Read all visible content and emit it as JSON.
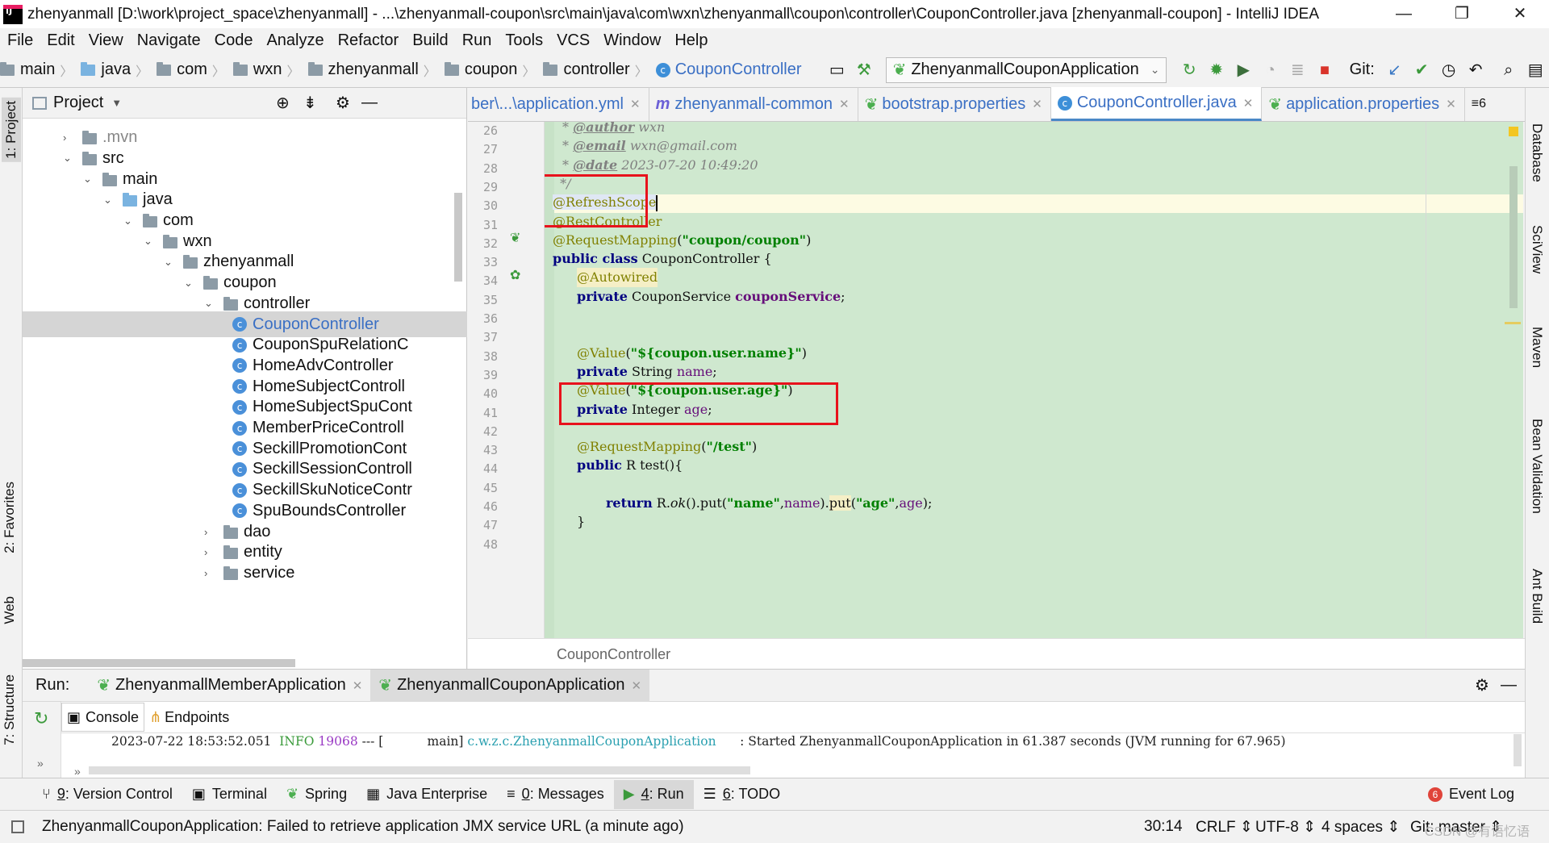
{
  "window": {
    "title": "zhenyanmall [D:\\work\\project_space\\zhenyanmall] - ...\\zhenyanmall-coupon\\src\\main\\java\\com\\wxn\\zhenyanmall\\coupon\\controller\\CouponController.java [zhenyanmall-coupon] - IntelliJ IDEA",
    "minimize": "—",
    "restore": "❐",
    "close": "✕"
  },
  "menu": [
    "File",
    "Edit",
    "View",
    "Navigate",
    "Code",
    "Analyze",
    "Refactor",
    "Build",
    "Run",
    "Tools",
    "VCS",
    "Window",
    "Help"
  ],
  "nav": {
    "crumbs": [
      "main",
      "java",
      "com",
      "wxn",
      "zhenyanmall",
      "coupon",
      "controller"
    ],
    "current_class": "CouponController",
    "run_config": "ZhenyanmallCouponApplication",
    "git_label": "Git:"
  },
  "project": {
    "header": "Project",
    "tree": [
      {
        "label": ".mvn",
        "indent": 0,
        "arrow": "›",
        "type": "folder"
      },
      {
        "label": "src",
        "indent": 0,
        "arrow": "⌄",
        "type": "folder"
      },
      {
        "label": "main",
        "indent": 1,
        "arrow": "⌄",
        "type": "folder"
      },
      {
        "label": "java",
        "indent": 2,
        "arrow": "⌄",
        "type": "folder-blue"
      },
      {
        "label": "com",
        "indent": 3,
        "arrow": "⌄",
        "type": "folder"
      },
      {
        "label": "wxn",
        "indent": 4,
        "arrow": "⌄",
        "type": "folder"
      },
      {
        "label": "zhenyanmall",
        "indent": 5,
        "arrow": "⌄",
        "type": "folder"
      },
      {
        "label": "coupon",
        "indent": 6,
        "arrow": "⌄",
        "type": "folder"
      },
      {
        "label": "controller",
        "indent": 7,
        "arrow": "⌄",
        "type": "folder"
      },
      {
        "label": "CouponController",
        "indent": 8,
        "arrow": "",
        "type": "class",
        "selected": true
      },
      {
        "label": "CouponSpuRelationC",
        "indent": 8,
        "arrow": "",
        "type": "class"
      },
      {
        "label": "HomeAdvController",
        "indent": 8,
        "arrow": "",
        "type": "class"
      },
      {
        "label": "HomeSubjectControll",
        "indent": 8,
        "arrow": "",
        "type": "class"
      },
      {
        "label": "HomeSubjectSpuCont",
        "indent": 8,
        "arrow": "",
        "type": "class"
      },
      {
        "label": "MemberPriceControll",
        "indent": 8,
        "arrow": "",
        "type": "class"
      },
      {
        "label": "SeckillPromotionCont",
        "indent": 8,
        "arrow": "",
        "type": "class"
      },
      {
        "label": "SeckillSessionControll",
        "indent": 8,
        "arrow": "",
        "type": "class"
      },
      {
        "label": "SeckillSkuNoticeContr",
        "indent": 8,
        "arrow": "",
        "type": "class"
      },
      {
        "label": "SpuBoundsController",
        "indent": 8,
        "arrow": "",
        "type": "class"
      },
      {
        "label": "dao",
        "indent": 7,
        "arrow": "›",
        "type": "folder"
      },
      {
        "label": "entity",
        "indent": 7,
        "arrow": "›",
        "type": "folder"
      },
      {
        "label": "service",
        "indent": 7,
        "arrow": "›",
        "type": "folder"
      }
    ]
  },
  "editor_tabs": [
    {
      "label": "ber\\...\\application.yml",
      "active": false
    },
    {
      "label": "zhenyanmall-common",
      "active": false
    },
    {
      "label": "bootstrap.properties",
      "active": false
    },
    {
      "label": "CouponController.java",
      "active": true
    },
    {
      "label": "application.properties",
      "active": false
    }
  ],
  "tab_overflow": "≡6",
  "line_numbers": [
    "26",
    "27",
    "28",
    "29",
    "30",
    "31",
    "32",
    "33",
    "34",
    "35",
    "36",
    "37",
    "38",
    "39",
    "40",
    "41",
    "42",
    "43",
    "44",
    "45",
    "46",
    "47",
    "48"
  ],
  "code": {
    "l26_tag": "@author",
    "l26_val": " wxn",
    "l27_tag": "@email",
    "l27_val": " wxn@gmail.com",
    "l28_tag": "@date",
    "l28_val": " 2023-07-20 10:49:20",
    "l29": " */",
    "l30": "@RefreshScope",
    "l31": "@RestController",
    "l32_ann": "@RequestMapping",
    "l32_str": "\"coupon/coupon\"",
    "l33_kw": "public class",
    "l33_rest": " CouponController {",
    "l34": "@Autowired",
    "l35_kw": "private",
    "l35_type": " CouponService ",
    "l35_field": "couponService",
    "l38_ann": "@Value",
    "l38_str": "\"${coupon.user.name}\"",
    "l39_kw": "private",
    "l39_type": " String ",
    "l39_field": "name",
    "l40_ann": "@Value",
    "l40_str": "\"${coupon.user.age}\"",
    "l41_kw": "private",
    "l41_type": " Integer ",
    "l41_field": "age",
    "l43_ann": "@RequestMapping",
    "l43_str": "\"/test\"",
    "l44_kw": "public",
    "l44_rest": " R test(){",
    "l46_kw": "return",
    "l46_a": " R.",
    "l46_ok": "ok",
    "l46_b": "().put(",
    "l46_s1": "\"name\"",
    "l46_f1": "name",
    "l46_c": ").",
    "l46_put2": "put",
    "l46_s2": "\"age\"",
    "l46_f2": "age",
    "l46_d": ");",
    "l47": "}"
  },
  "editor_breadcrumb": "CouponController",
  "run": {
    "label": "Run:",
    "tabs": [
      "ZhenyanmallMemberApplication",
      "ZhenyanmallCouponApplication"
    ],
    "console_tab": "Console",
    "endpoints_tab": "Endpoints",
    "log": {
      "timestamp": "2023-07-22 18:53:52.051",
      "level": "INFO",
      "pid": "19068",
      "dashes": "---",
      "thread": "[           main]",
      "logger": "c.w.z.c.ZhenyanmallCouponApplication",
      "message": ": Started ZhenyanmallCouponApplication in 61.387 seconds (JVM running for 67.965)"
    }
  },
  "bottom_tools": [
    {
      "num": "9",
      "label": ": Version Control",
      "icon": "⑂"
    },
    {
      "num": "",
      "label": "Terminal",
      "icon": "▣"
    },
    {
      "num": "",
      "label": "Spring",
      "icon": "❦"
    },
    {
      "num": "",
      "label": "Java Enterprise",
      "icon": "▦"
    },
    {
      "num": "0",
      "label": ": Messages",
      "icon": "≡"
    },
    {
      "num": "4",
      "label": ": Run",
      "icon": "▶"
    },
    {
      "num": "6",
      "label": ": TODO",
      "icon": "☰"
    }
  ],
  "event_log": {
    "badge": "6",
    "label": "Event Log"
  },
  "left_strip": [
    "1: Project",
    "2: Favorites",
    "Web",
    "7: Structure"
  ],
  "right_strip": [
    "Database",
    "SciView",
    "Maven",
    "Bean Validation",
    "Ant Build"
  ],
  "status": {
    "message": "ZhenyanmallCouponApplication: Failed to retrieve application JMX service URL (a minute ago)",
    "position": "30:14",
    "line_sep": "CRLF ⇕",
    "encoding": "UTF-8 ⇕",
    "indent": "4 spaces ⇕",
    "git": "Git: master ⇕",
    "watermark": "CSDN @有语忆语"
  }
}
